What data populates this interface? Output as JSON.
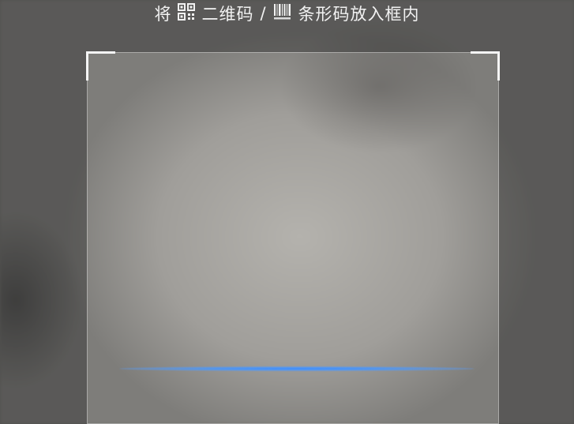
{
  "hint": {
    "prefix": "将",
    "qr_label": "二维码",
    "separator": "/",
    "barcode_label": "条形码放入框内"
  },
  "icons": {
    "qr": "qr-code-icon",
    "barcode": "barcode-icon"
  },
  "colors": {
    "scan_line": "#3c8cff",
    "frame_corner": "#f5f5f5",
    "hint_text": "#f2f2f2"
  }
}
